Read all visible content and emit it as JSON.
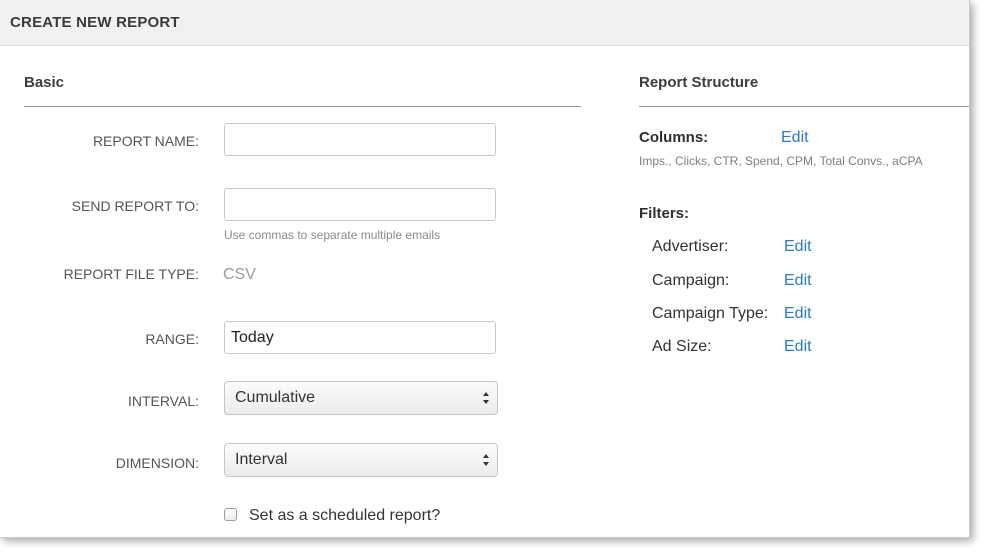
{
  "header": {
    "title": "CREATE NEW REPORT"
  },
  "basic": {
    "section_title": "Basic",
    "report_name": {
      "label": "REPORT NAME:",
      "value": "",
      "placeholder": ""
    },
    "send_report_to": {
      "label": "SEND REPORT TO:",
      "value": "",
      "placeholder": "",
      "hint": "Use commas to separate multiple emails"
    },
    "report_file_type": {
      "label": "REPORT FILE TYPE:",
      "value": "CSV"
    },
    "range": {
      "label": "RANGE:",
      "value": "Today"
    },
    "interval": {
      "label": "INTERVAL:",
      "selected": "Cumulative"
    },
    "dimension": {
      "label": "DIMENSION:",
      "selected": "Interval"
    },
    "scheduled": {
      "label": "Set as a scheduled report?",
      "checked": false
    }
  },
  "report_structure": {
    "section_title": "Report Structure",
    "columns": {
      "label": "Columns:",
      "edit": "Edit",
      "list": "Imps., Clicks, CTR, Spend, CPM, Total Convs., aCPA"
    },
    "filters": {
      "label": "Filters:",
      "items": [
        {
          "label": "Advertiser:",
          "edit": "Edit"
        },
        {
          "label": "Campaign:",
          "edit": "Edit"
        },
        {
          "label": "Campaign Type:",
          "edit": "Edit"
        },
        {
          "label": "Ad Size:",
          "edit": "Edit"
        }
      ]
    }
  },
  "colors": {
    "link": "#2a7bc8",
    "header_bg": "#f1f1f1"
  }
}
